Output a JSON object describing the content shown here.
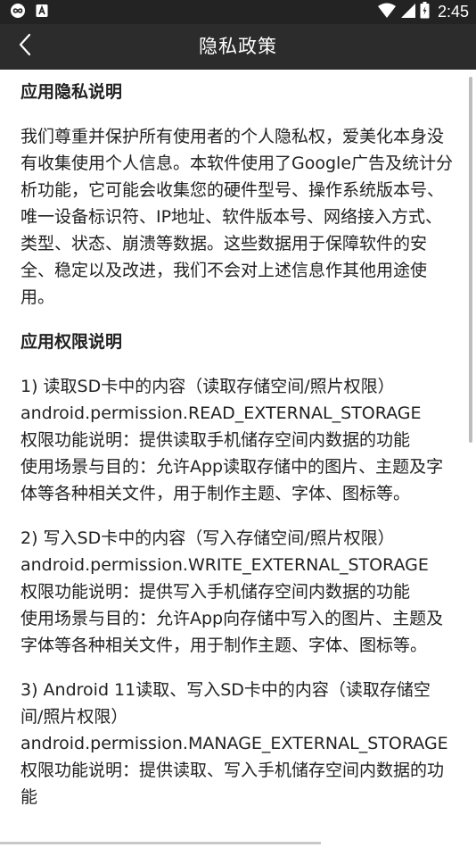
{
  "status_bar": {
    "time": "2:45",
    "icons": [
      "infinity-app-icon",
      "a-box-icon",
      "wifi-icon",
      "cell-signal-icon",
      "battery-icon"
    ]
  },
  "app_bar": {
    "title": "隐私政策",
    "back_icon": "chevron-left-icon"
  },
  "content": {
    "privacy_title": "应用隐私说明",
    "privacy_body": "我们尊重并保护所有使用者的个人隐私权，爱美化本身没有收集使用个人信息。本软件使用了Google广告及统计分析功能，它可能会收集您的硬件型号、操作系统版本号、唯一设备标识符、IP地址、软件版本号、网络接入方式、类型、状态、崩溃等数据。这些数据用于保障软件的安全、稳定以及改进，我们不会对上述信息作其他用途使用。",
    "permissions_title": "应用权限说明",
    "permissions": [
      {
        "heading": "1) 读取SD卡中的内容（读取存储空间/照片权限）",
        "permission": "android.permission.READ_EXTERNAL_STORAGE",
        "function": "权限功能说明：提供读取手机储存空间内数据的功能",
        "purpose": "使用场景与目的：允许App读取存储中的图片、主题及字体等各种相关文件，用于制作主题、字体、图标等。"
      },
      {
        "heading": "2) 写入SD卡中的内容（写入存储空间/照片权限）",
        "permission": "android.permission.WRITE_EXTERNAL_STORAGE",
        "function": "权限功能说明：提供写入手机储存空间内数据的功能",
        "purpose": "使用场景与目的：允许App向存储中写入的图片、主题及字体等各种相关文件，用于制作主题、字体、图标等。"
      },
      {
        "heading": "3) Android 11读取、写入SD卡中的内容（读取存储空间/照片权限）",
        "permission": "android.permission.MANAGE_EXTERNAL_STORAGE",
        "function": "权限功能说明：提供读取、写入手机储存空间内数据的功能",
        "purpose": ""
      }
    ]
  },
  "colors": {
    "status_bar_bg": "#232323",
    "app_bar_bg": "#2c2c2c",
    "text": "#222222"
  }
}
